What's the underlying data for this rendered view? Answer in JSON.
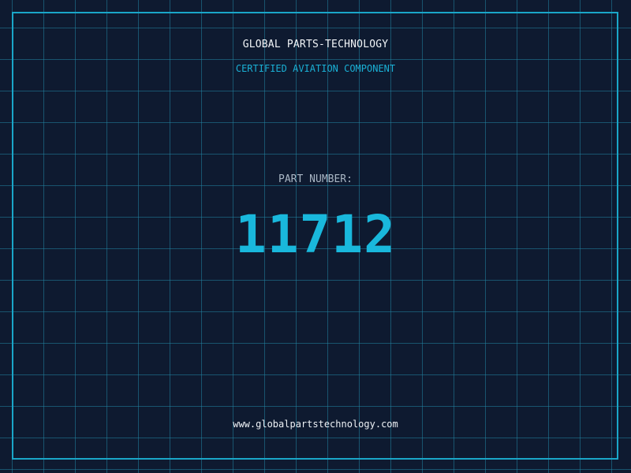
{
  "header": {
    "company": "GLOBAL PARTS-TECHNOLOGY",
    "tagline": "CERTIFIED AVIATION COMPONENT"
  },
  "part": {
    "label": "PART NUMBER:",
    "number": "11712"
  },
  "footer": {
    "url": "www.globalpartstechnology.com"
  },
  "colors": {
    "background": "#0e1a30",
    "grid": "#2282a0",
    "accent": "#19b8dc",
    "frame": "#1aa6c8"
  }
}
